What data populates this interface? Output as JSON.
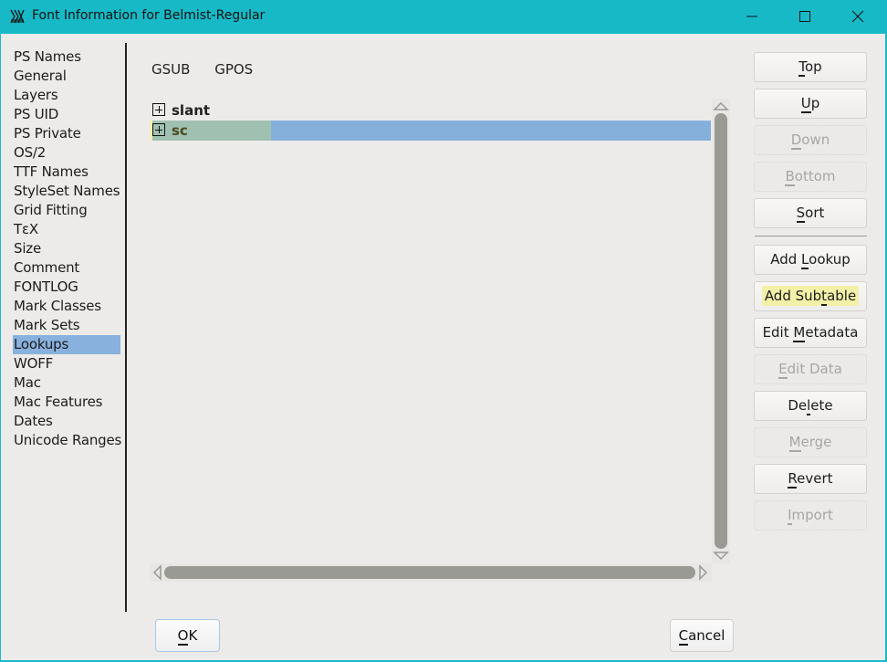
{
  "window": {
    "title": "Font Information for Belmist-Regular",
    "icon": "fontforge-app-icon",
    "controls": {
      "minimize": "minimize-icon",
      "maximize": "maximize-icon",
      "close": "close-icon"
    },
    "frame_color": "#17b9c6"
  },
  "sidebar": {
    "selected": "Lookups",
    "items": [
      {
        "label": "PS Names"
      },
      {
        "label": "General"
      },
      {
        "label": "Layers"
      },
      {
        "label": "PS UID"
      },
      {
        "label": "PS Private"
      },
      {
        "label": "OS/2"
      },
      {
        "label": "TTF Names"
      },
      {
        "label": "StyleSet Names"
      },
      {
        "label": "Grid Fitting"
      },
      {
        "label": "TεX"
      },
      {
        "label": "Size"
      },
      {
        "label": "Comment"
      },
      {
        "label": "FONTLOG"
      },
      {
        "label": "Mark Classes"
      },
      {
        "label": "Mark Sets"
      },
      {
        "label": "Lookups"
      },
      {
        "label": "WOFF"
      },
      {
        "label": "Mac"
      },
      {
        "label": "Mac Features"
      },
      {
        "label": "Dates"
      },
      {
        "label": "Unicode Ranges"
      }
    ]
  },
  "subtabs": [
    {
      "label": "GSUB"
    },
    {
      "label": "GPOS"
    }
  ],
  "lookups": [
    {
      "label": "slant",
      "selected": false
    },
    {
      "label": "sc",
      "selected": true
    }
  ],
  "buttons": {
    "top": {
      "pre": "",
      "mn": "T",
      "post": "op",
      "enabled": true
    },
    "up": {
      "pre": "",
      "mn": "U",
      "post": "p",
      "enabled": true
    },
    "down": {
      "pre": "",
      "mn": "D",
      "post": "own",
      "enabled": false
    },
    "bottom": {
      "pre": "",
      "mn": "B",
      "post": "ottom",
      "enabled": false
    },
    "sort": {
      "pre": "",
      "mn": "S",
      "post": "ort",
      "enabled": true
    },
    "add_lookup": {
      "pre": "Add ",
      "mn": "L",
      "post": "ookup",
      "enabled": true
    },
    "add_subtable": {
      "pre": "Add Sub",
      "mn": "t",
      "post": "able",
      "enabled": true
    },
    "edit_metadata": {
      "pre": "Edit ",
      "mn": "M",
      "post": "etadata",
      "enabled": true
    },
    "edit_data": {
      "pre": "",
      "mn": "E",
      "post": "dit Data",
      "enabled": false
    },
    "delete": {
      "pre": "De",
      "mn": "l",
      "post": "ete",
      "enabled": true
    },
    "merge": {
      "pre": "",
      "mn": "M",
      "post": "erge",
      "enabled": false
    },
    "revert": {
      "pre": "",
      "mn": "R",
      "post": "evert",
      "enabled": true
    },
    "import": {
      "pre": "",
      "mn": "I",
      "post": "mport",
      "enabled": false
    }
  },
  "footer": {
    "ok": {
      "pre": "",
      "mn": "O",
      "post": "K"
    },
    "cancel": {
      "pre": "",
      "mn": "C",
      "post": "ancel"
    }
  }
}
